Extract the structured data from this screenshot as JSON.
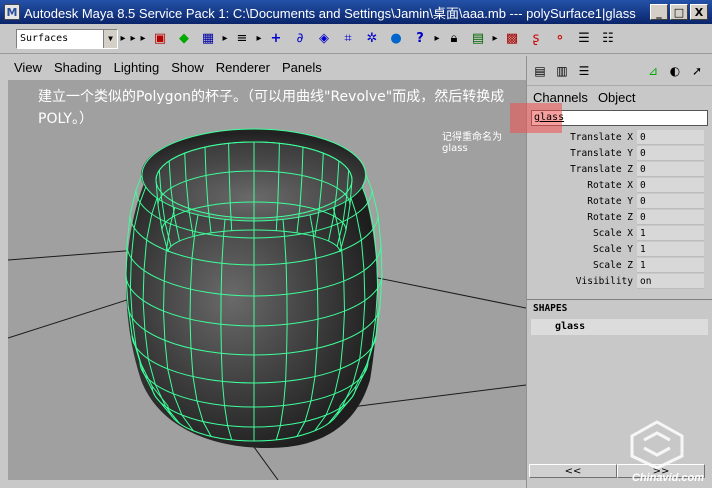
{
  "window": {
    "title": "Autodesk Maya 8.5 Service Pack 1: C:\\Documents and Settings\\Jamin\\桌面\\aaa.mb   ---   polySurface1|glass",
    "title_right": "",
    "buttons": [
      "_",
      "□",
      "X"
    ]
  },
  "toolbar": {
    "menu_set": "Surfaces",
    "icons": [
      "select-tool-icon",
      "lasso-icon",
      "paint-icon",
      "move-icon",
      "rotate-icon",
      "scale-icon",
      "manipulator-icon",
      "soft-mod-icon",
      "sphere-icon",
      "help-icon",
      "lock-icon",
      "snap-icon",
      "history-icon",
      "render-icon"
    ]
  },
  "viewport": {
    "menu": [
      "View",
      "Shading",
      "Lighting",
      "Show",
      "Renderer",
      "Panels"
    ],
    "note": "建立一个类似的Polygon的杯子。（可以用曲线\"Revolve\"而成，然后转换成POLY。）",
    "note2": "记得重命名为glass"
  },
  "channel_box": {
    "tabs": [
      "Channels",
      "Object"
    ],
    "object_name": "glass",
    "attributes": [
      {
        "label": "Translate X",
        "value": "0"
      },
      {
        "label": "Translate Y",
        "value": "0"
      },
      {
        "label": "Translate Z",
        "value": "0"
      },
      {
        "label": "Rotate X",
        "value": "0"
      },
      {
        "label": "Rotate Y",
        "value": "0"
      },
      {
        "label": "Rotate Z",
        "value": "0"
      },
      {
        "label": "Scale X",
        "value": "1"
      },
      {
        "label": "Scale Y",
        "value": "1"
      },
      {
        "label": "Scale Z",
        "value": "1"
      },
      {
        "label": "Visibility",
        "value": "on"
      }
    ],
    "shapes_header": "SHAPES",
    "shape_name": "glass",
    "scroll_left": "<<",
    "scroll_right": ">>"
  },
  "watermark": "Chinavid.com",
  "colors": {
    "wireframe": "#3dff9a",
    "titlebar": "#0a246a",
    "highlight": "#f05050"
  }
}
